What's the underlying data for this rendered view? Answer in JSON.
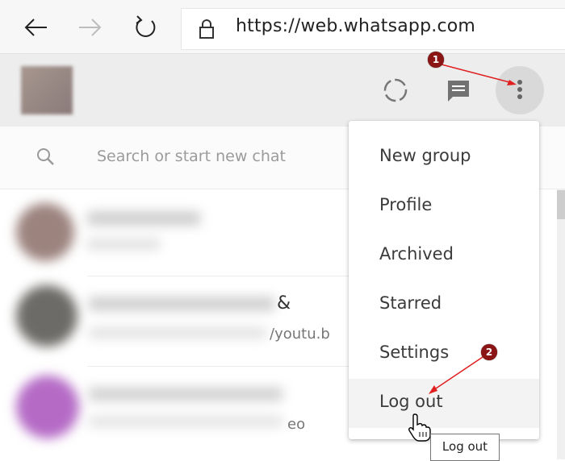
{
  "browser": {
    "url": "https://web.whatsapp.com"
  },
  "search": {
    "placeholder": "Search or start new chat"
  },
  "chats": [
    {
      "preview_suffix": "&"
    },
    {
      "preview_suffix": "/youtu.b"
    },
    {
      "preview_suffix": "eo"
    }
  ],
  "menu": {
    "items": [
      {
        "label": "New group"
      },
      {
        "label": "Profile"
      },
      {
        "label": "Archived"
      },
      {
        "label": "Starred"
      },
      {
        "label": "Settings"
      },
      {
        "label": "Log out"
      }
    ]
  },
  "tooltip": {
    "text": "Log out"
  },
  "annotations": [
    {
      "label": "1"
    },
    {
      "label": "2"
    }
  ],
  "colors": {
    "annotation": "#8b1515",
    "arrow": "#e02020",
    "header_bg": "#ededed"
  }
}
